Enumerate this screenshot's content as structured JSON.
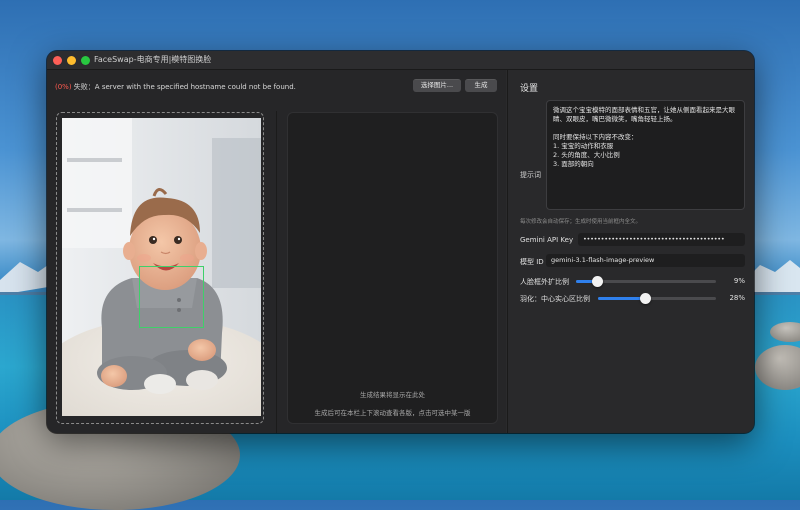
{
  "window": {
    "title": "FaceSwap-电商专用|模特图换脸"
  },
  "toolbar": {
    "status_prefix": "(0%)",
    "status_message": " 失败：A server with the specified hostname could not be found.",
    "choose_image_label": "选择图片...",
    "generate_label": "生成"
  },
  "result": {
    "placeholder_line1": "生成结果将显示在此处",
    "placeholder_line2": "生成后可在本栏上下滚动查看各版，点击可选中某一版"
  },
  "settings": {
    "title": "设置",
    "prompt_label": "提示词",
    "prompt_text": "微调这个宝宝模特的面部表情和五官，让她从侧面看起来是大眼睛、双眼皮，嘴巴微微笑，嘴角轻轻上扬。\n\n同时要保持以下内容不改变：\n1. 宝宝的动作和衣服\n2. 头的角度、大小比例\n3. 面部的朝向",
    "autosave_hint": "每次修改会自动保存；生成时使用当前框内全文。",
    "api_key_label": "Gemini API Key",
    "api_key_value": "••••••••••••••••••••••••••••••••••••••••",
    "model_id_label": "模型 ID",
    "model_id_value": "gemini-3.1-flash-image-preview",
    "face_expand_label": "人脸框外扩比例",
    "face_expand_value": 9,
    "face_expand_text": "9%",
    "feather_label": "羽化：中心实心区比例",
    "feather_value": 28,
    "feather_text": "28%"
  },
  "colors": {
    "accent": "#2f80ed",
    "error": "#ff5a4f",
    "face_box": "#3fd06a"
  }
}
